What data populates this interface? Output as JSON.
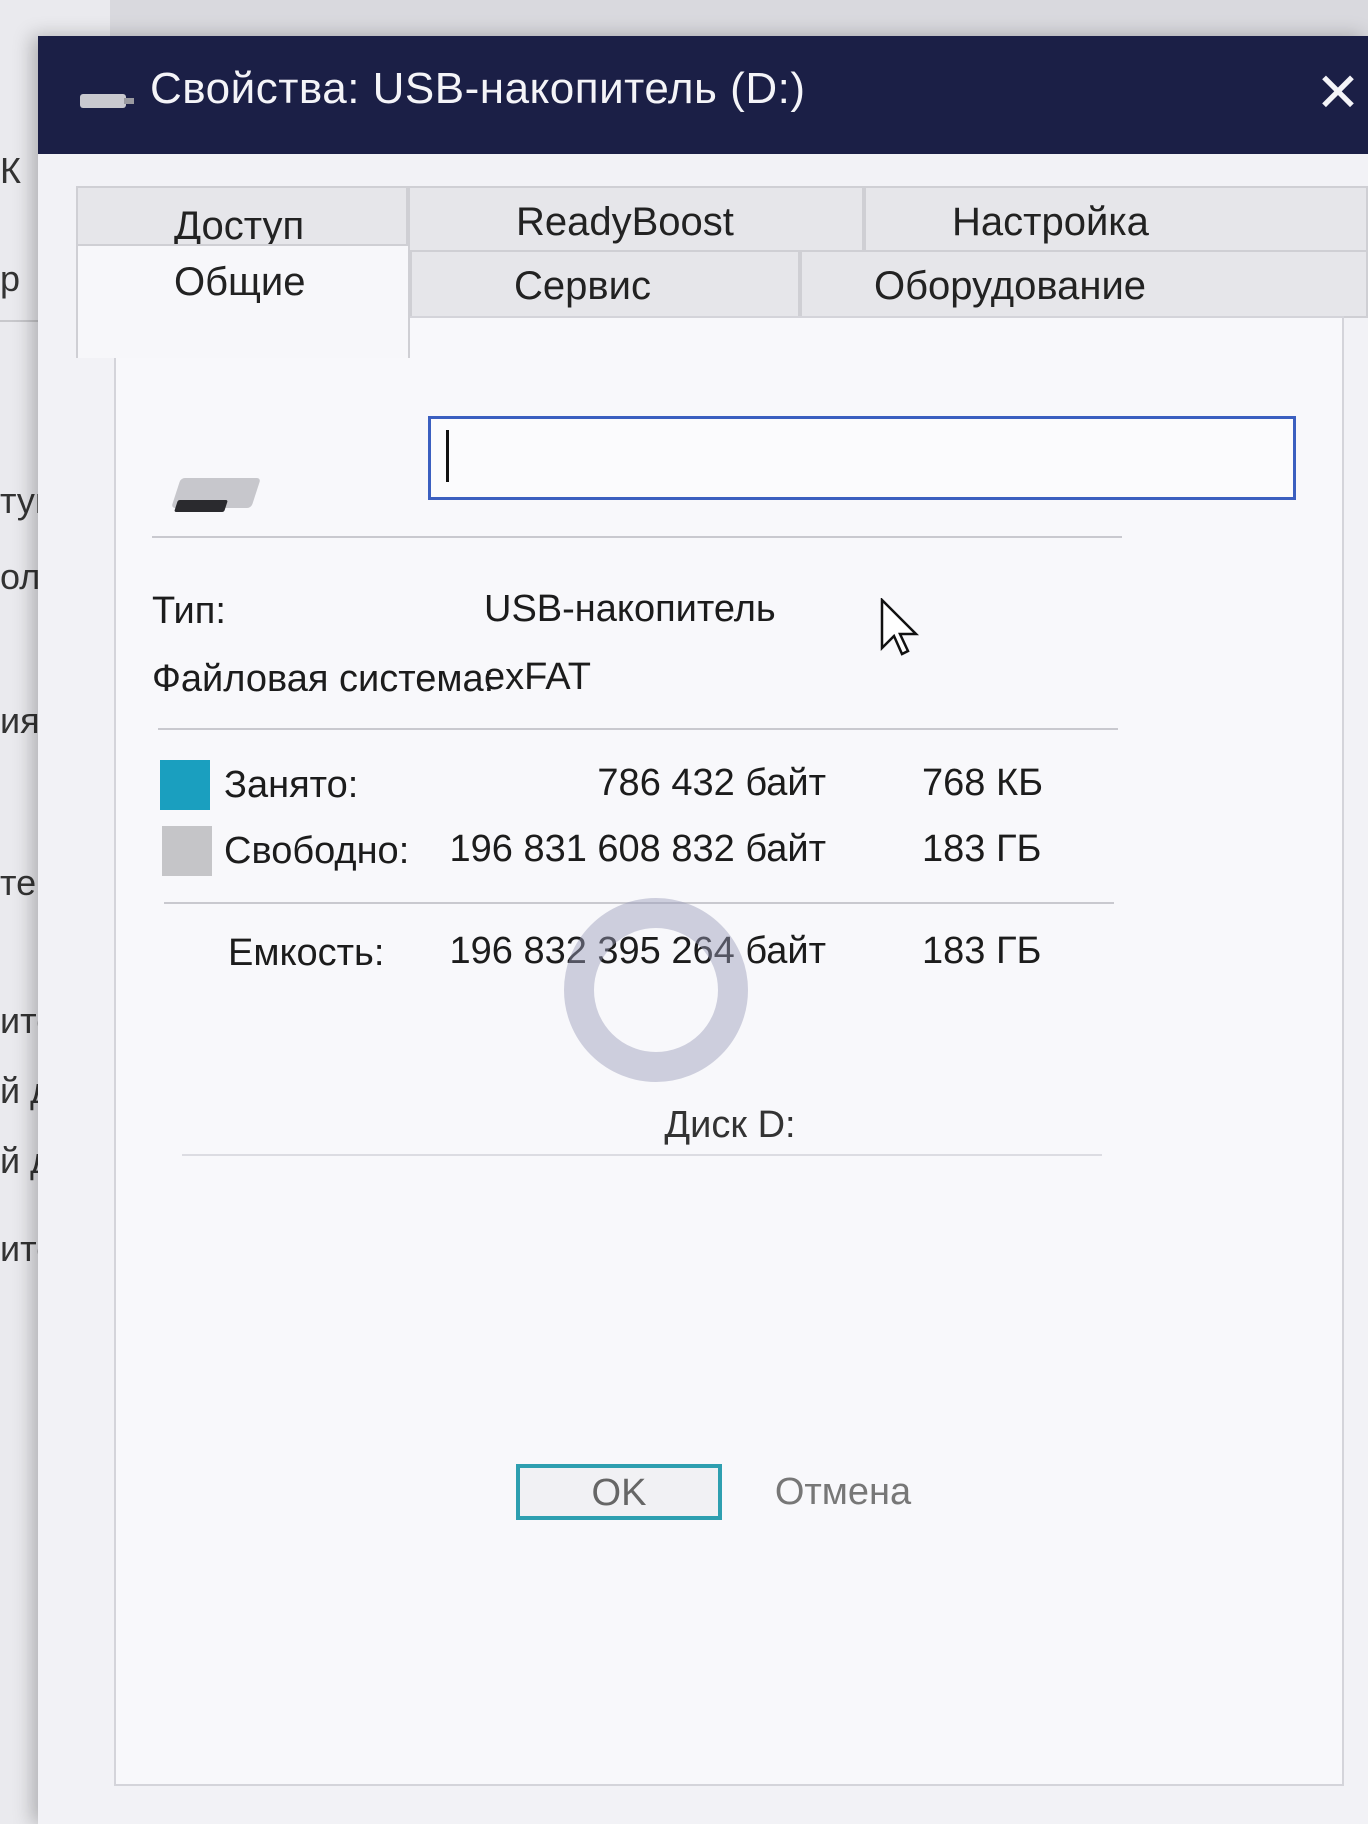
{
  "background_window": {
    "fragments": [
      "К",
      "р",
      "туп",
      "ол",
      "ия",
      "тер",
      "ител",
      "й дис",
      "й дис",
      "итель"
    ]
  },
  "dialog": {
    "title": "Свойства: USB-накопитель (D:)",
    "close_glyph": "✕"
  },
  "tabs": {
    "row1": [
      "Доступ",
      "ReadyBoost",
      "Настройка"
    ],
    "row2": [
      "Общие",
      "Сервис",
      "Оборудование"
    ],
    "active": "Общие"
  },
  "general": {
    "name_value": "",
    "type_label": "Тип:",
    "type_value": "USB-накопитель",
    "fs_label": "Файловая система:",
    "fs_value": "exFAT",
    "used_label": "Занято:",
    "used_bytes": "786 432 байт",
    "used_size": "768 КБ",
    "free_label": "Свободно:",
    "free_bytes": "196 831 608 832 байт",
    "free_size": "183 ГБ",
    "capacity_label": "Емкость:",
    "capacity_bytes": "196 832 395 264 байт",
    "capacity_size": "183 ГБ",
    "disk_label": "Диск D:",
    "used_color": "#1a9fbf",
    "free_color": "#c5c5c8"
  },
  "buttons": {
    "ok": "OK",
    "cancel": "Отмена"
  }
}
